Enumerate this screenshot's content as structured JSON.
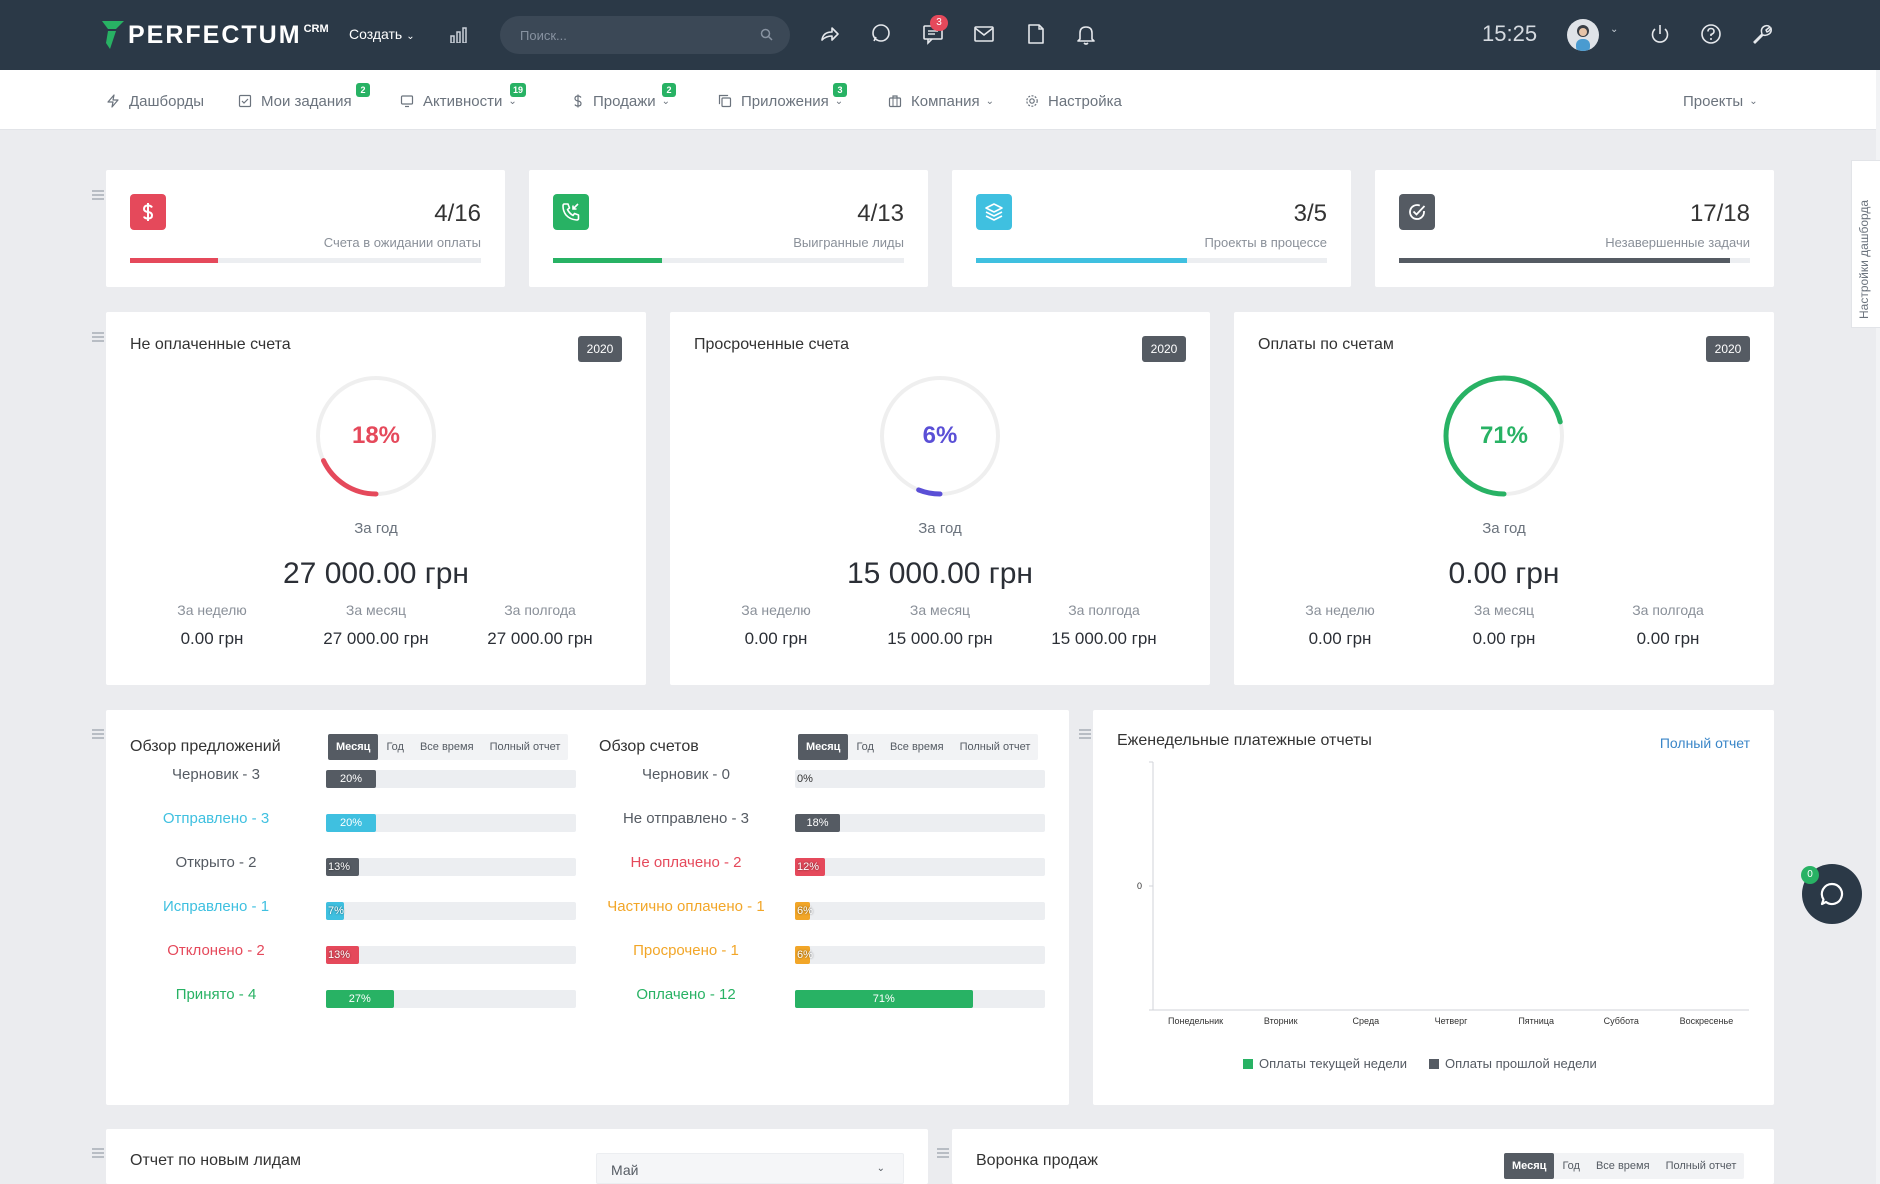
{
  "header": {
    "logo_text": "PERFECTUM",
    "logo_sup": "CRM",
    "create_label": "Создать",
    "search_placeholder": "Поиск...",
    "messages_badge": "3",
    "clock": "15:25"
  },
  "nav": {
    "items": [
      {
        "label": "Дашборды",
        "icon": "lightning-icon"
      },
      {
        "label": "Мои задания",
        "icon": "checkbox-icon",
        "badge": "2"
      },
      {
        "label": "Активности",
        "icon": "monitor-icon",
        "badge": "19"
      },
      {
        "label": "Продажи",
        "icon": "dollar-icon",
        "badge": "2"
      },
      {
        "label": "Приложения",
        "icon": "copy-icon",
        "badge": "3"
      },
      {
        "label": "Компания",
        "icon": "briefcase-icon"
      },
      {
        "label": "Настройка",
        "icon": "gear-icon"
      }
    ],
    "projects_label": "Проекты"
  },
  "side_tab_label": "Настройки дашборда",
  "stats": [
    {
      "value": "4/16",
      "label": "Счета в ожидании оплаты",
      "progress": 0.25,
      "color": "#e5495b",
      "icon": "dollar-icon"
    },
    {
      "value": "4/13",
      "label": "Выигранные лиды",
      "progress": 0.31,
      "color": "#28b264",
      "icon": "phone-incoming-icon"
    },
    {
      "value": "3/5",
      "label": "Проекты в процессе",
      "progress": 0.6,
      "color": "#3fc0e0",
      "icon": "layers-icon"
    },
    {
      "value": "17/18",
      "label": "Незавершенные задачи",
      "progress": 0.944,
      "color": "#555b63",
      "icon": "check-circle-icon"
    }
  ],
  "invoice_cards": [
    {
      "title": "Не оплаченные счета",
      "year": "2020",
      "percent": "18%",
      "fraction": 0.18,
      "color": "#e5495b",
      "period": "За год",
      "amount": "27 000.00 грн",
      "week_label": "За неделю",
      "week": "0.00 грн",
      "month_label": "За месяц",
      "month": "27 000.00 грн",
      "half_label": "За полгода",
      "half": "27 000.00 грн"
    },
    {
      "title": "Просроченные счета",
      "year": "2020",
      "percent": "6%",
      "fraction": 0.06,
      "color": "#5a4fd6",
      "period": "За год",
      "amount": "15 000.00 грн",
      "week_label": "За неделю",
      "week": "0.00 грн",
      "month_label": "За месяц",
      "month": "15 000.00 грн",
      "half_label": "За полгода",
      "half": "15 000.00 грн"
    },
    {
      "title": "Оплаты по счетам",
      "year": "2020",
      "percent": "71%",
      "fraction": 0.71,
      "color": "#28b264",
      "period": "За год",
      "amount": "0.00 грн",
      "week_label": "За неделю",
      "week": "0.00 грн",
      "month_label": "За месяц",
      "month": "0.00 грн",
      "half_label": "За полгода",
      "half": "0.00 грн"
    }
  ],
  "tabs": [
    "Месяц",
    "Год",
    "Все время",
    "Полный отчет"
  ],
  "proposals": {
    "title": "Обзор предложений",
    "rows": [
      {
        "label": "Черновик - 3",
        "pct": "20%",
        "value": 0.2,
        "color": "#555b63",
        "text_color": "#555b63"
      },
      {
        "label": "Отправлено - 3",
        "pct": "20%",
        "value": 0.2,
        "color": "#3fc0e0",
        "text_color": "#3fc0e0"
      },
      {
        "label": "Открыто - 2",
        "pct": "13%",
        "value": 0.13,
        "color": "#555b63",
        "text_color": "#555b63"
      },
      {
        "label": "Исправлено - 1",
        "pct": "7%",
        "value": 0.07,
        "color": "#3fc0e0",
        "text_color": "#3fc0e0"
      },
      {
        "label": "Отклонено - 2",
        "pct": "13%",
        "value": 0.13,
        "color": "#e5495b",
        "text_color": "#e5495b"
      },
      {
        "label": "Принято - 4",
        "pct": "27%",
        "value": 0.27,
        "color": "#28b264",
        "text_color": "#28b264"
      }
    ]
  },
  "invoices": {
    "title": "Обзор счетов",
    "rows": [
      {
        "label": "Черновик - 0",
        "pct": "0%",
        "value": 0.0,
        "color": "#555b63",
        "text_color": "#555b63"
      },
      {
        "label": "Не отправлено - 3",
        "pct": "18%",
        "value": 0.18,
        "color": "#555b63",
        "text_color": "#555b63"
      },
      {
        "label": "Не оплачено - 2",
        "pct": "12%",
        "value": 0.12,
        "color": "#e5495b",
        "text_color": "#e5495b"
      },
      {
        "label": "Частично оплачено - 1",
        "pct": "6%",
        "value": 0.06,
        "color": "#f2a628",
        "text_color": "#f2a628"
      },
      {
        "label": "Просрочено - 1",
        "pct": "6%",
        "value": 0.06,
        "color": "#f2a628",
        "text_color": "#f2a628"
      },
      {
        "label": "Оплачено - 12",
        "pct": "71%",
        "value": 0.71,
        "color": "#28b264",
        "text_color": "#28b264"
      }
    ]
  },
  "weekly": {
    "title": "Еженедельные платежные отчеты",
    "link": "Полный отчет"
  },
  "chart_data": {
    "type": "bar",
    "categories": [
      "Понедельник",
      "Вторник",
      "Среда",
      "Четверг",
      "Пятница",
      "Суббота",
      "Воскресенье"
    ],
    "series": [
      {
        "name": "Оплаты текущей недели",
        "values": [
          0,
          0,
          0,
          0,
          0,
          0,
          0
        ],
        "color": "#28b264"
      },
      {
        "name": "Оплаты прошлой недели",
        "values": [
          0,
          0,
          0,
          0,
          0,
          0,
          0
        ],
        "color": "#555b63"
      }
    ],
    "yticks": [
      "0"
    ],
    "legend": "bottom"
  },
  "leads_report": {
    "title": "Отчет по новым лидам",
    "select_value": "Май"
  },
  "funnel": {
    "title": "Воронка продаж"
  },
  "chat_badge": "0"
}
